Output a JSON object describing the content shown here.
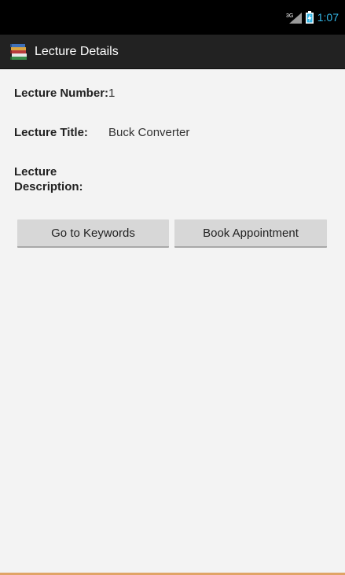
{
  "status_bar": {
    "network_label": "3G",
    "time": "1:07",
    "signal_icon": "signal-icon",
    "battery_icon": "battery-charging-icon",
    "time_color": "#33b5e5"
  },
  "action_bar": {
    "app_icon": "books-icon",
    "title": "Lecture Details"
  },
  "details": {
    "number_label": "Lecture Number:",
    "number_value": "1",
    "title_label": "Lecture Title:",
    "title_value": "Buck Converter",
    "description_label_line1": "Lecture",
    "description_label_line2": "Description:",
    "description_value": ""
  },
  "buttons": {
    "keywords_label": "Go to Keywords",
    "appointment_label": "Book Appointment"
  }
}
